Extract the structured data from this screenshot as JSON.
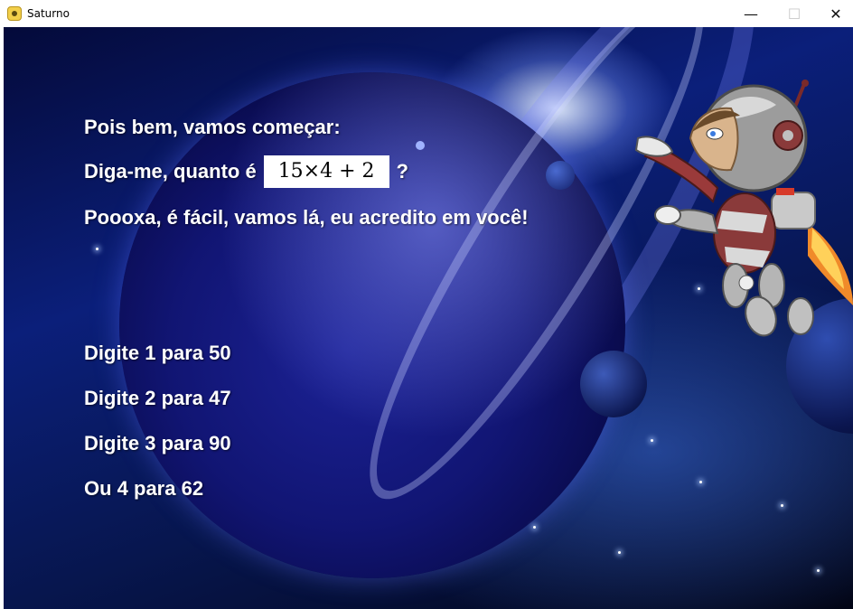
{
  "window": {
    "title": "Saturno",
    "minimize_glyph": "—",
    "maximize_glyph": "☐",
    "close_glyph": "✕"
  },
  "game": {
    "intro": "Pois bem, vamos começar:",
    "question_prefix": "Diga-me, quanto é",
    "expression": "15×4 + 2",
    "question_suffix": "?",
    "encouragement": "Poooxa, é fácil, vamos lá, eu acredito em você!",
    "options": [
      "Digite 1 para 50",
      "Digite 2 para 47",
      "Digite 3 para 90",
      "Ou 4 para 62"
    ]
  }
}
